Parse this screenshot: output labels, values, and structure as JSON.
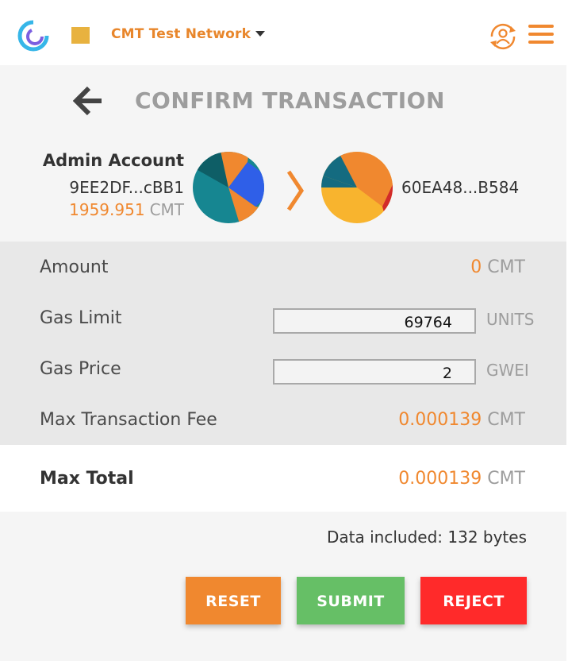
{
  "header": {
    "network_name": "CMT Test Network",
    "network_color": "#e8b23f",
    "accent_color": "#f0882f"
  },
  "page": {
    "title": "CONFIRM TRANSACTION"
  },
  "from": {
    "name": "Admin Account",
    "address": "9EE2DF...cBB1",
    "balance": "1959.951",
    "balance_unit": "CMT"
  },
  "to": {
    "address": "60EA48...B584"
  },
  "details": {
    "amount_label": "Amount",
    "amount_value": "0",
    "amount_unit": "CMT",
    "gas_limit_label": "Gas Limit",
    "gas_limit_value": "69764",
    "gas_limit_unit": "UNITS",
    "gas_price_label": "Gas Price",
    "gas_price_value": "2",
    "gas_price_unit": "GWEI",
    "max_fee_label": "Max Transaction Fee",
    "max_fee_value": "0.000139",
    "max_fee_unit": "CMT"
  },
  "total": {
    "label": "Max Total",
    "value": "0.000139",
    "unit": "CMT"
  },
  "data_included": "Data included: 132 bytes",
  "buttons": {
    "reset": "RESET",
    "submit": "SUBMIT",
    "reject": "REJECT"
  }
}
